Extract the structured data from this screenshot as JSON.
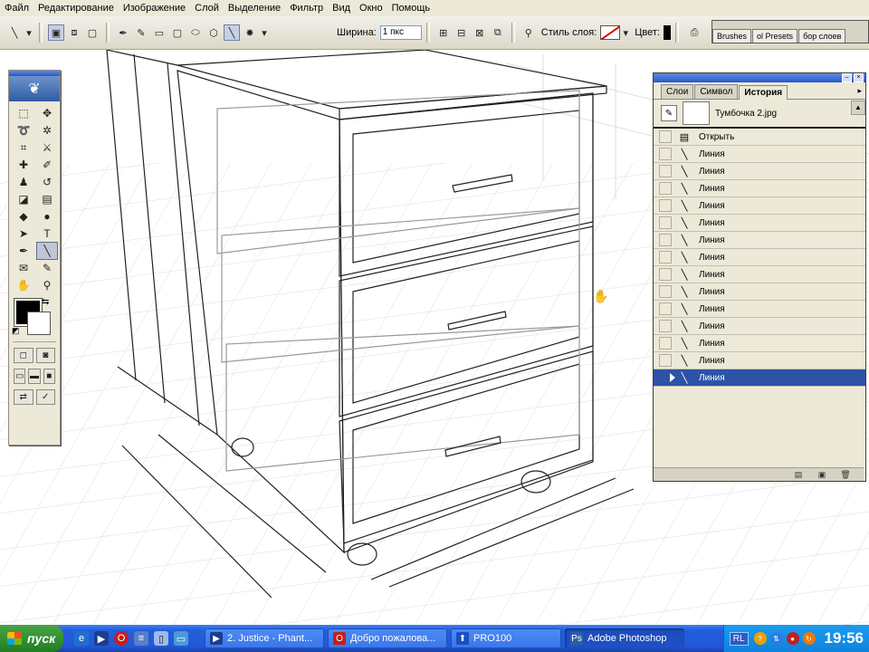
{
  "menu": [
    "Файл",
    "Редактирование",
    "Изображение",
    "Слой",
    "Выделение",
    "Фильтр",
    "Вид",
    "Окно",
    "Помощь"
  ],
  "options_bar": {
    "width_label": "Ширина:",
    "width_value": "1 пкс",
    "layer_style_label": "Стиль слоя:",
    "color_label": "Цвет:",
    "panel_well_tabs": [
      "Brushes",
      "ol Presets",
      "бор слоев"
    ]
  },
  "history_panel": {
    "tabs": [
      "Слои",
      "Символ",
      "История"
    ],
    "active_tab": "История",
    "snapshot_name": "Тумбочка 2.jpg",
    "items": [
      "Открыть",
      "Линия",
      "Линия",
      "Линия",
      "Линия",
      "Линия",
      "Линия",
      "Линия",
      "Линия",
      "Линия",
      "Линия",
      "Линия",
      "Линия",
      "Линия",
      "Линия"
    ],
    "selected_index": 14
  },
  "tools": {
    "foreground_color": "#000000",
    "background_color": "#ffffff"
  },
  "taskbar": {
    "start_label": "пуск",
    "tasks": [
      {
        "label": "2. Justice - Phant...",
        "icon": "media-player-icon"
      },
      {
        "label": "Добро пожалова...",
        "icon": "opera-icon"
      },
      {
        "label": "PRO100",
        "icon": "pro100-icon"
      },
      {
        "label": "Adobe Photoshop",
        "icon": "photoshop-icon",
        "active": true
      }
    ],
    "language": "RL",
    "clock": "19:56"
  },
  "colors": {
    "accent_blue": "#2c53a6",
    "taskbar_blue": "#245edb",
    "start_green": "#2b8a2b"
  }
}
